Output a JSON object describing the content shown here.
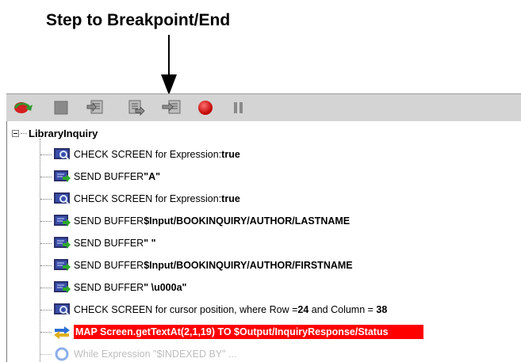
{
  "callout": {
    "title": "Step to Breakpoint/End"
  },
  "toolbar": {
    "buttons": [
      {
        "name": "run-icon"
      },
      {
        "name": "stop-icon"
      },
      {
        "name": "step-into-icon"
      },
      {
        "name": "step-over-icon"
      },
      {
        "name": "step-to-breakpoint-icon"
      },
      {
        "name": "record-icon"
      },
      {
        "name": "pause-icon"
      }
    ]
  },
  "tree": {
    "root_label": "LibraryInquiry",
    "rows": [
      {
        "icon": "check-screen-icon",
        "text": "CHECK SCREEN for Expression: ",
        "bold": "true"
      },
      {
        "icon": "send-buffer-icon",
        "text": "SEND BUFFER ",
        "bold": "\"A\""
      },
      {
        "icon": "check-screen-icon",
        "text": "CHECK SCREEN for Expression: ",
        "bold": "true"
      },
      {
        "icon": "send-buffer-icon",
        "text": "SEND BUFFER ",
        "bold": "$Input/BOOKINQUIRY/AUTHOR/LASTNAME"
      },
      {
        "icon": "send-buffer-icon",
        "text": "SEND BUFFER ",
        "bold": "\" \""
      },
      {
        "icon": "send-buffer-icon",
        "text": "SEND BUFFER ",
        "bold": "$Input/BOOKINQUIRY/AUTHOR/FIRSTNAME"
      },
      {
        "icon": "send-buffer-icon",
        "text": "SEND BUFFER ",
        "bold": "\" \\u000a\""
      },
      {
        "icon": "check-screen-icon",
        "text": "CHECK SCREEN for cursor position, where Row = ",
        "bold": "24",
        "text2": " and Column = ",
        "bold2": "38"
      },
      {
        "icon": "map-icon",
        "text": "MAP Screen.getTextAt(2,1,19) TO $Output/InquiryResponse/Status",
        "selected": true
      },
      {
        "icon": "while-loop-icon",
        "text": "While Expression \"$INDEXED BY\" ...",
        "partial": true
      }
    ]
  }
}
